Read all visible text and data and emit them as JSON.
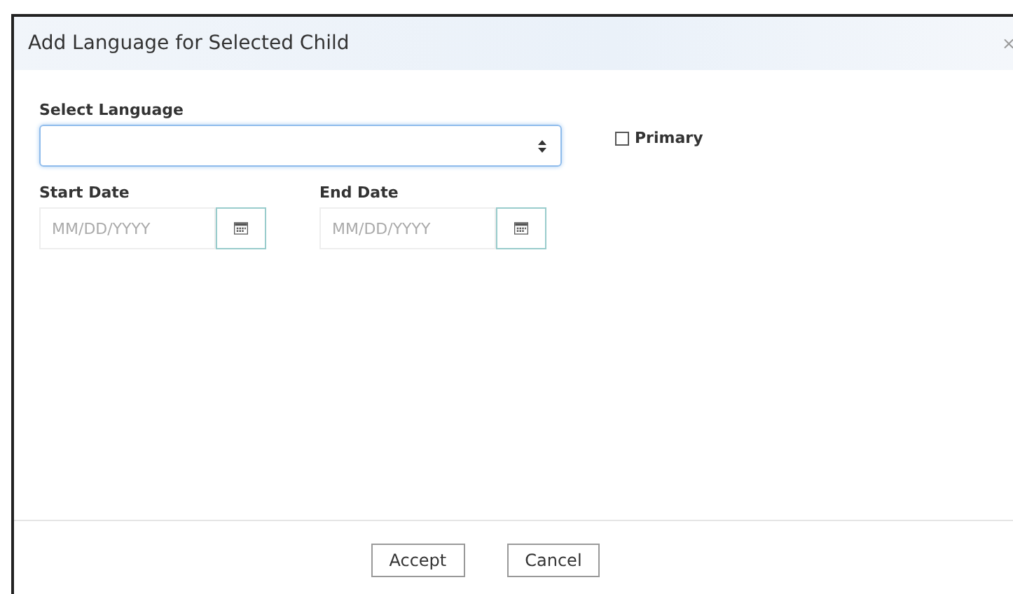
{
  "dialog": {
    "title": "Add Language for Selected Child",
    "close": "×"
  },
  "language": {
    "label": "Select Language"
  },
  "primary": {
    "label": "Primary",
    "checked": false
  },
  "start_date": {
    "label": "Start Date",
    "placeholder": "MM/DD/YYYY"
  },
  "end_date": {
    "label": "End Date",
    "placeholder": "MM/DD/YYYY"
  },
  "buttons": [
    "Accept",
    "Cancel"
  ]
}
